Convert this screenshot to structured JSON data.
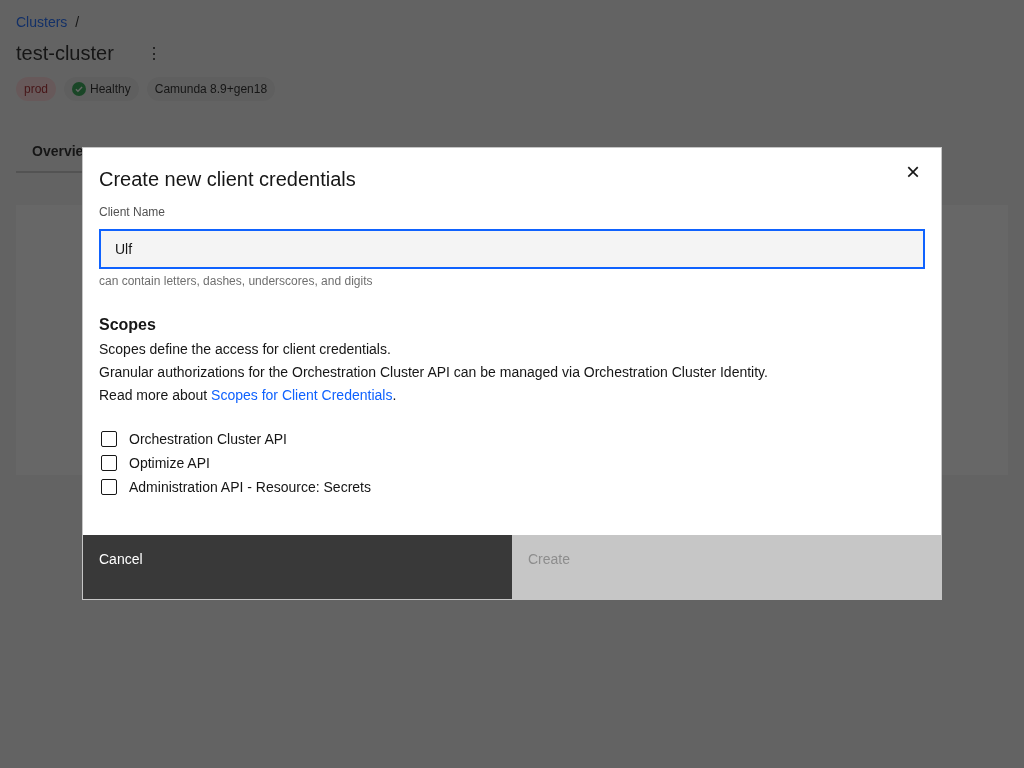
{
  "breadcrumb": {
    "link": "Clusters",
    "separator": "/"
  },
  "cluster": {
    "title": "test-cluster",
    "menu": "⋮"
  },
  "tags": [
    {
      "label": "prod",
      "kind": "environment"
    },
    {
      "label": "Healthy",
      "kind": "status"
    },
    {
      "label": "Camunda 8.9+gen18",
      "kind": "version"
    }
  ],
  "tabs": [
    {
      "label": "Overvie",
      "selected": true
    }
  ],
  "dialog": {
    "title": "Create new client credentials",
    "close": "×",
    "field": {
      "label": "Client Name",
      "value": "Ulf",
      "focused": true,
      "helper": "can contain letters, dashes, underscores, and digits"
    },
    "scopes_heading": "Scopes",
    "paragraphs": [
      "Scopes define the access for client credentials.",
      "Granular authorizations for the Orchestration Cluster API can be managed via Orchestration Cluster Identity."
    ],
    "read_more": {
      "before": "Read more about ",
      "link": "Scopes for Client Credentials",
      "after": "."
    },
    "scopes": [
      {
        "label": "Orchestration Cluster API",
        "checked": false
      },
      {
        "label": "Optimize API",
        "checked": false
      },
      {
        "label": "Administration API - Resource: Secrets",
        "checked": false
      }
    ],
    "cancel": {
      "label": "Cancel"
    },
    "create": {
      "label": "Create",
      "disabled": true
    }
  }
}
